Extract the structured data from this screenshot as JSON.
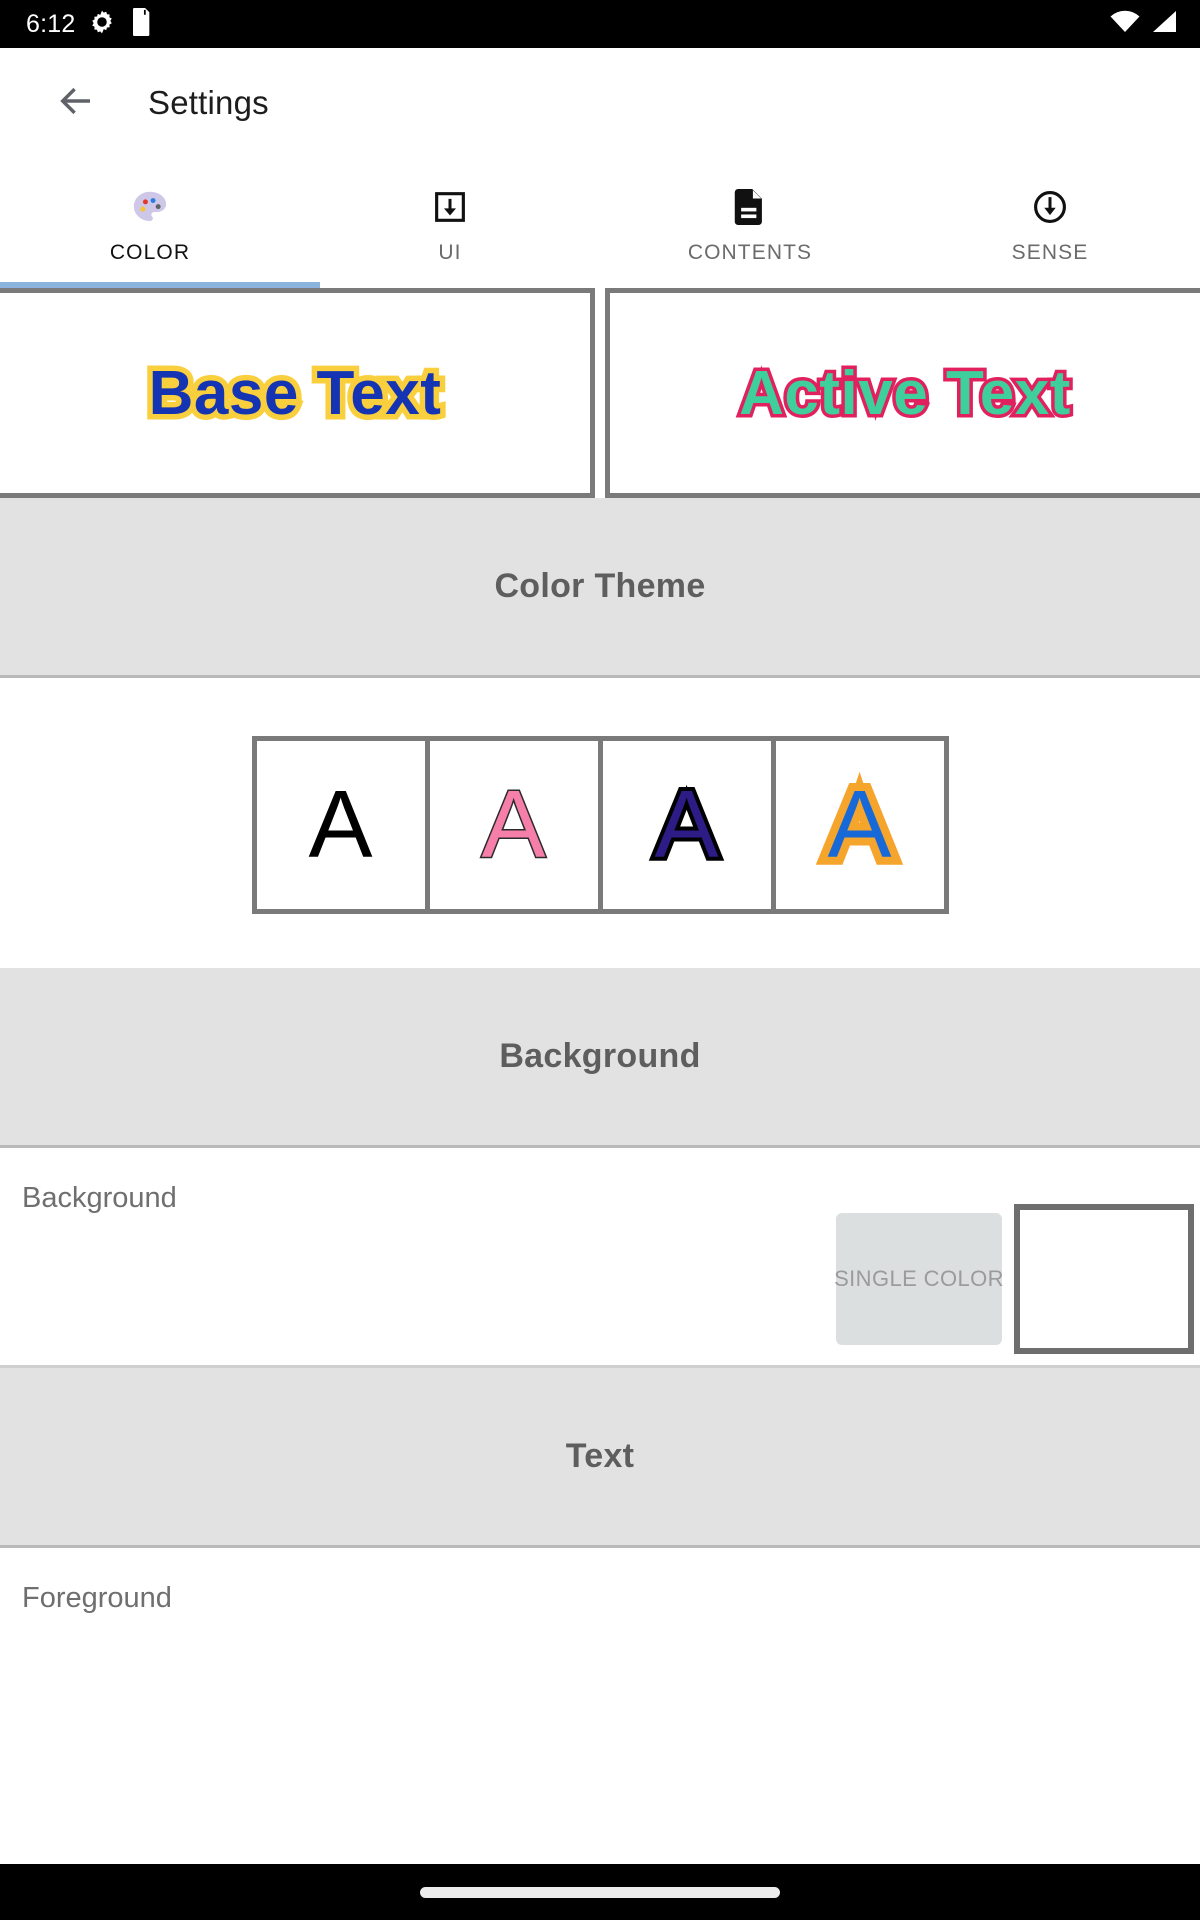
{
  "status_bar": {
    "time": "6:12",
    "icons_left": [
      "settings-gear-icon",
      "sd-card-icon"
    ],
    "icons_right": [
      "wifi-icon",
      "cellular-signal-icon"
    ]
  },
  "app_bar": {
    "back_icon": "arrow-left-icon",
    "title": "Settings"
  },
  "tabs": {
    "active_index": 0,
    "indicator_color": "#8AB4DE",
    "items": [
      {
        "label": "COLOR",
        "icon": "palette-icon"
      },
      {
        "label": "UI",
        "icon": "download-box-icon"
      },
      {
        "label": "CONTENTS",
        "icon": "document-icon"
      },
      {
        "label": "SENSE",
        "icon": "circle-arrow-down-icon"
      }
    ]
  },
  "preview": {
    "base": {
      "text": "Base Text",
      "fill_color": "#1434B4",
      "outline_color": "#F9CF3D"
    },
    "active": {
      "text": "Active Text",
      "fill_color": "#3ECF9C",
      "outline_color": "#E0215E"
    }
  },
  "sections": {
    "color_theme": {
      "title": "Color Theme"
    },
    "background": {
      "title": "Background"
    },
    "text": {
      "title": "Text"
    }
  },
  "color_theme": {
    "swatches": [
      {
        "glyph": "A",
        "fill_color": "#000000",
        "outline_color": "none"
      },
      {
        "glyph": "A",
        "fill_color": "#F57FA8",
        "outline_color": "#2B2B2B"
      },
      {
        "glyph": "A",
        "fill_color": "#2D1B86",
        "outline_color": "#000000"
      },
      {
        "glyph": "A",
        "fill_color": "#1769D8",
        "outline_color": "#F6A52C"
      }
    ]
  },
  "background_row": {
    "label": "Background",
    "mode_button_label": "SINGLE COLOR",
    "swatch_color": "#FFFFFF",
    "swatch_border_color": "#6E6E6E"
  },
  "text_row": {
    "label": "Foreground"
  },
  "nav_bar": {
    "home_indicator": "home-indicator-pill"
  }
}
